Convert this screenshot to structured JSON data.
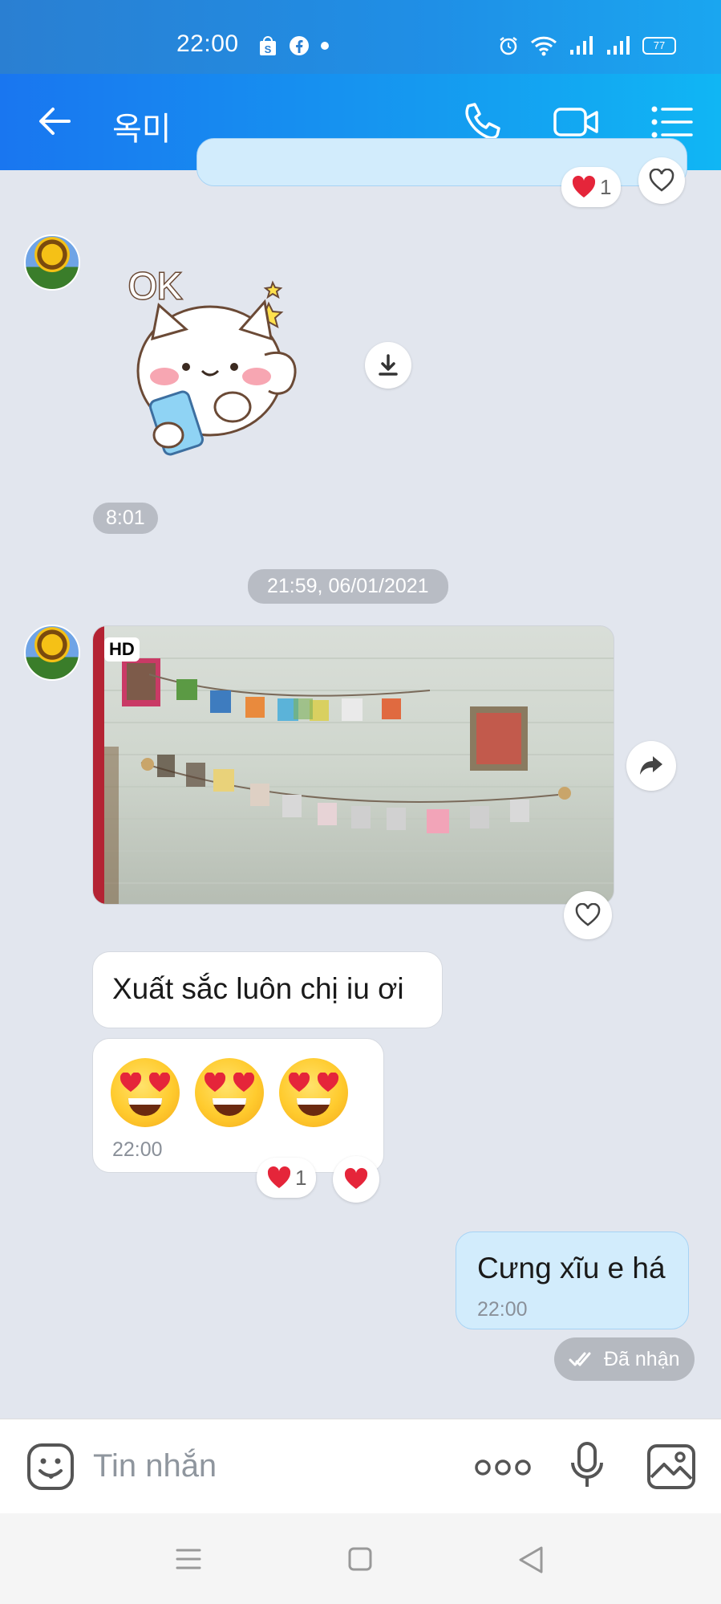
{
  "status_bar": {
    "time": "22:00",
    "battery": "77",
    "icons": [
      "shop-icon",
      "facebook-icon",
      "dot-icon",
      "alarm-icon",
      "wifi-icon",
      "signal-icon",
      "signal-icon",
      "battery-icon"
    ]
  },
  "header": {
    "title": "옥미",
    "icons": [
      "back-arrow-icon",
      "phone-icon",
      "video-call-icon",
      "menu-list-icon"
    ]
  },
  "messages": {
    "top_reaction": {
      "emoji": "❤️",
      "count": "1"
    },
    "sticker": {
      "caption": "OK",
      "time": "8:01"
    },
    "date_separator": "21:59, 06/01/2021",
    "photo": {
      "badge": "HD"
    },
    "text_in_1": "Xuất sắc luôn chị iu ơi",
    "emoji_msg": {
      "emojis": "😍😍😍",
      "time": "22:00",
      "reaction_count": "1"
    },
    "text_out": {
      "text": "Cưng xĩu e há",
      "time": "22:00"
    },
    "status": "Đã nhận"
  },
  "input": {
    "placeholder": "Tin nhắn"
  },
  "colors": {
    "header_start": "#1976f0",
    "header_end": "#10b6f4",
    "bg": "#e2e6ee",
    "out_bubble": "#d2ecfc",
    "heart": "#e5253a"
  }
}
